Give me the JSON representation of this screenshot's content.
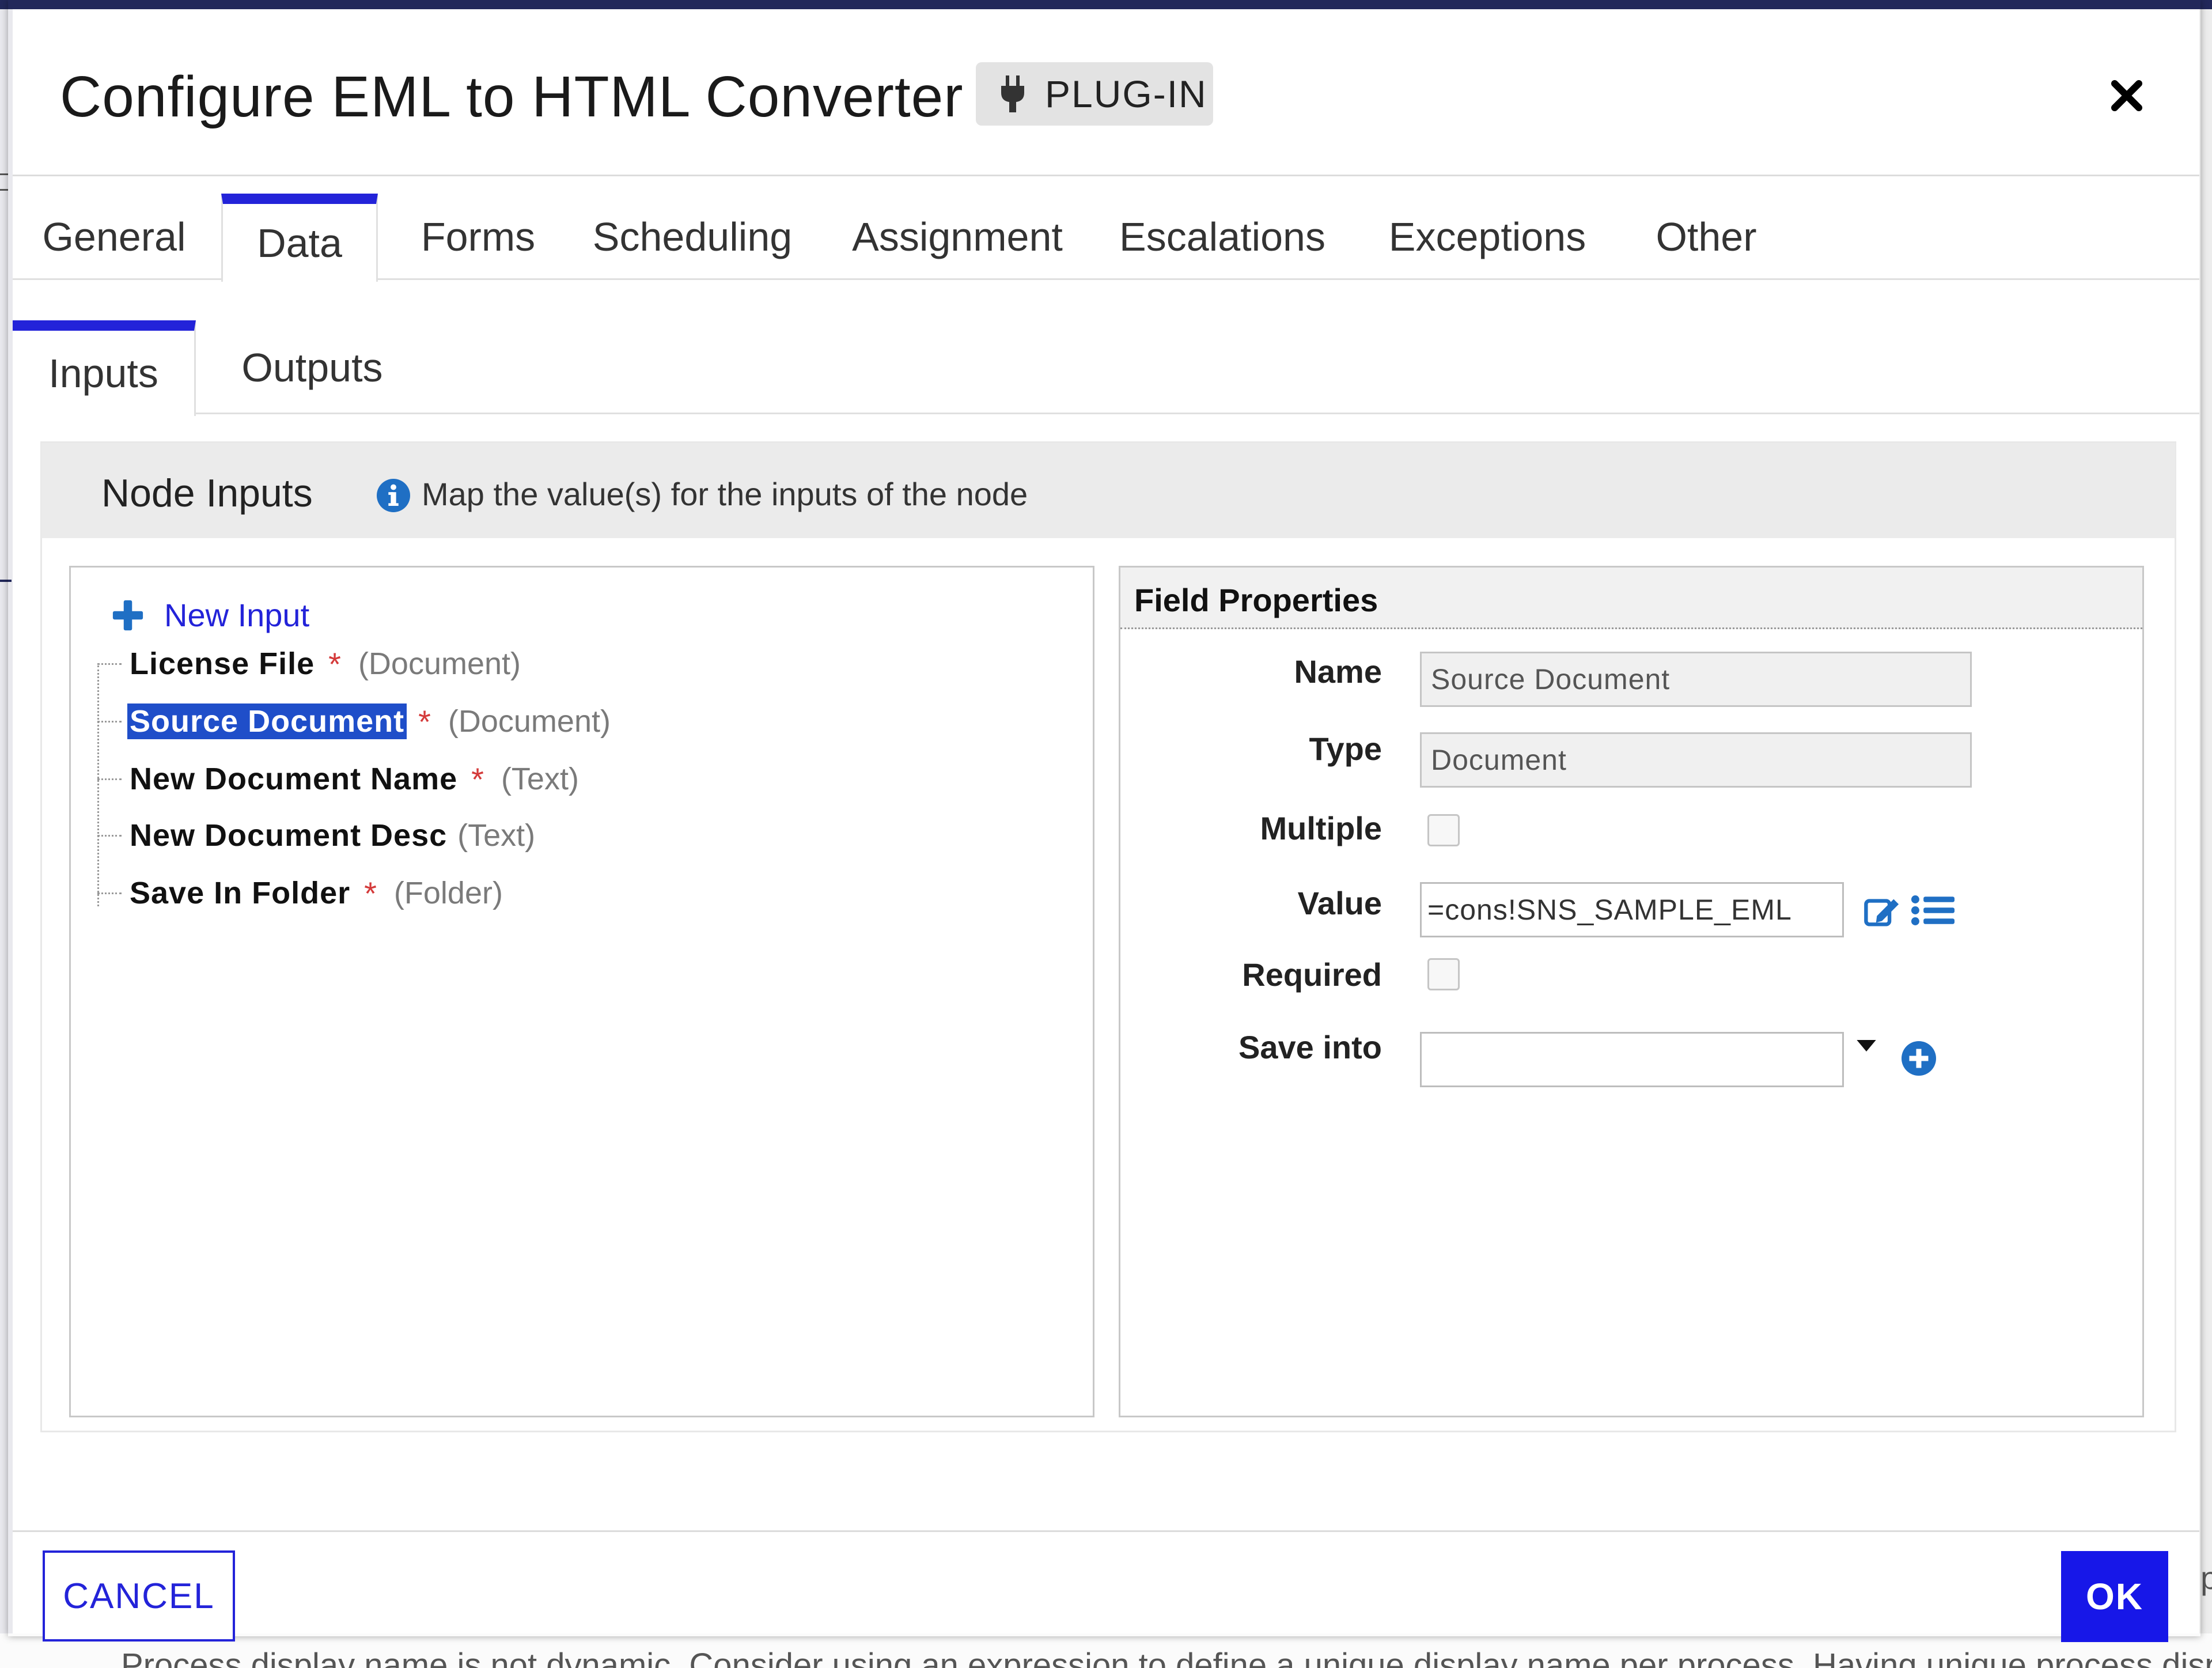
{
  "dialog": {
    "title": "Configure EML to HTML Converter",
    "badge": "PLUG-IN",
    "close_icon": "close-icon"
  },
  "tabs": [
    {
      "label": "General",
      "active": false
    },
    {
      "label": "Data",
      "active": true
    },
    {
      "label": "Forms",
      "active": false
    },
    {
      "label": "Scheduling",
      "active": false
    },
    {
      "label": "Assignment",
      "active": false
    },
    {
      "label": "Escalations",
      "active": false
    },
    {
      "label": "Exceptions",
      "active": false
    },
    {
      "label": "Other",
      "active": false
    }
  ],
  "subtabs": [
    {
      "label": "Inputs",
      "active": true
    },
    {
      "label": "Outputs",
      "active": false
    }
  ],
  "node_inputs": {
    "title": "Node Inputs",
    "description": "Map the value(s) for the inputs of the node",
    "new_input_label": "New Input",
    "items": [
      {
        "name": "License File",
        "required": "*",
        "type": "(Document)",
        "selected": false
      },
      {
        "name": "Source Document",
        "required": "*",
        "type": "(Document)",
        "selected": true
      },
      {
        "name": "New Document Name",
        "required": "*",
        "type": "(Text)",
        "selected": false
      },
      {
        "name": "New Document Desc",
        "required": "",
        "type": "(Text)",
        "selected": false
      },
      {
        "name": "Save In Folder",
        "required": "*",
        "type": "(Folder)",
        "selected": false
      }
    ]
  },
  "field_properties": {
    "title": "Field Properties",
    "name_label": "Name",
    "name_value": "Source Document",
    "type_label": "Type",
    "type_value": "Document",
    "multiple_label": "Multiple",
    "value_label": "Value",
    "value_value": "=cons!SNS_SAMPLE_EML",
    "required_label": "Required",
    "save_into_label": "Save into",
    "save_into_value": ""
  },
  "footer": {
    "cancel_label": "CANCEL",
    "ok_label": "OK"
  },
  "backdrop": {
    "bottom_text": "Process display name is not dynamic. Consider using an expression to define a unique display name per process. Having unique process display names",
    "right_glyph": "p"
  },
  "colors": {
    "accent": "#2323d9",
    "ok_button": "#1717e8",
    "selection": "#1f4ec9",
    "required_star": "#d43a3a",
    "icon_blue": "#1f6fc4"
  }
}
